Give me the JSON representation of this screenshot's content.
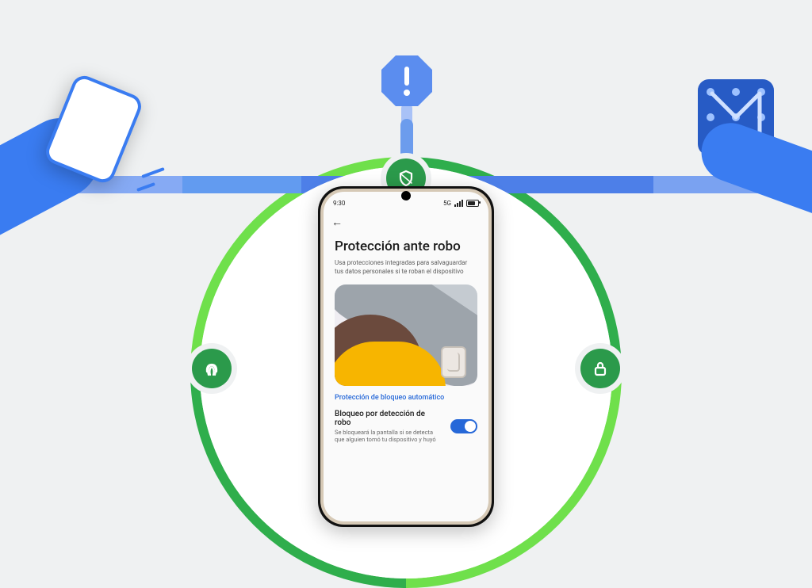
{
  "statusbar": {
    "time": "9:30",
    "network_label": "5G"
  },
  "page": {
    "title": "Protección ante robo",
    "subtitle": "Usa protecciones integradas para salvaguardar tus datos personales si te roban el dispositivo"
  },
  "section_link": "Protección de bloqueo automático",
  "theft_lock": {
    "title": "Bloqueo por detección de robo",
    "description": "Se bloqueará la pantalla si se detecta que alguien tomó tu dispositivo y huyó",
    "enabled": true
  },
  "badges": {
    "top": "shield",
    "left": "fingerprint",
    "right": "lock"
  },
  "alert_icon": "exclamation"
}
